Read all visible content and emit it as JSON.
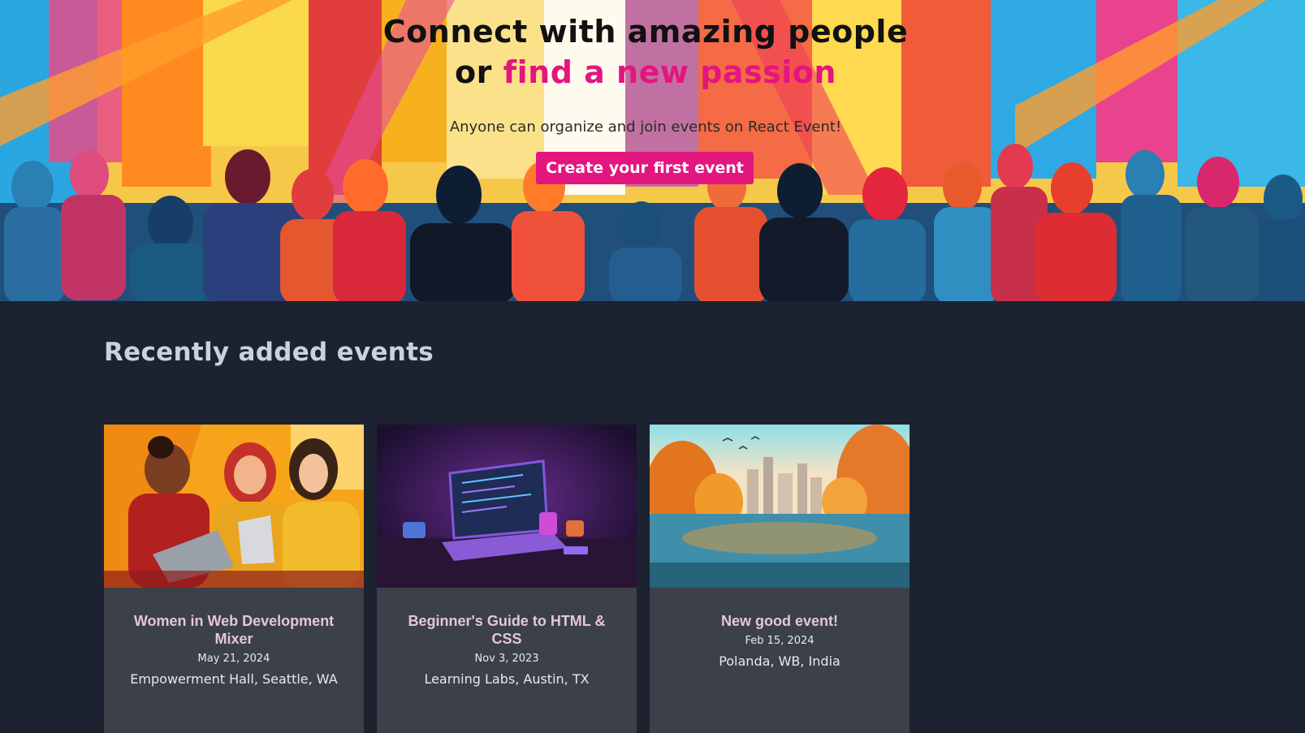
{
  "hero": {
    "title_line1": "Connect with amazing people",
    "title_or": "or",
    "title_accent": "find a new passion",
    "subtitle": "Anyone can organize and join events on React Event!",
    "cta_label": "Create your first event",
    "accent_color": "#e3157f"
  },
  "section": {
    "title": "Recently added events"
  },
  "events": [
    {
      "title": "Women in Web Development Mixer",
      "date": "May 21, 2024",
      "location": "Empowerment Hall, Seattle, WA",
      "image": "women-coding-illustration"
    },
    {
      "title": "Beginner's Guide to HTML & CSS",
      "date": "Nov 3, 2023",
      "location": "Learning Labs, Austin, TX",
      "image": "laptop-desk-illustration"
    },
    {
      "title": "New good event!",
      "date": "Feb 15, 2024",
      "location": "Polanda, WB, India",
      "image": "autumn-city-lake-illustration"
    }
  ],
  "colors": {
    "page_bg": "#1d2230",
    "card_bg": "#3b4049",
    "card_title": "#e7c4dd"
  }
}
